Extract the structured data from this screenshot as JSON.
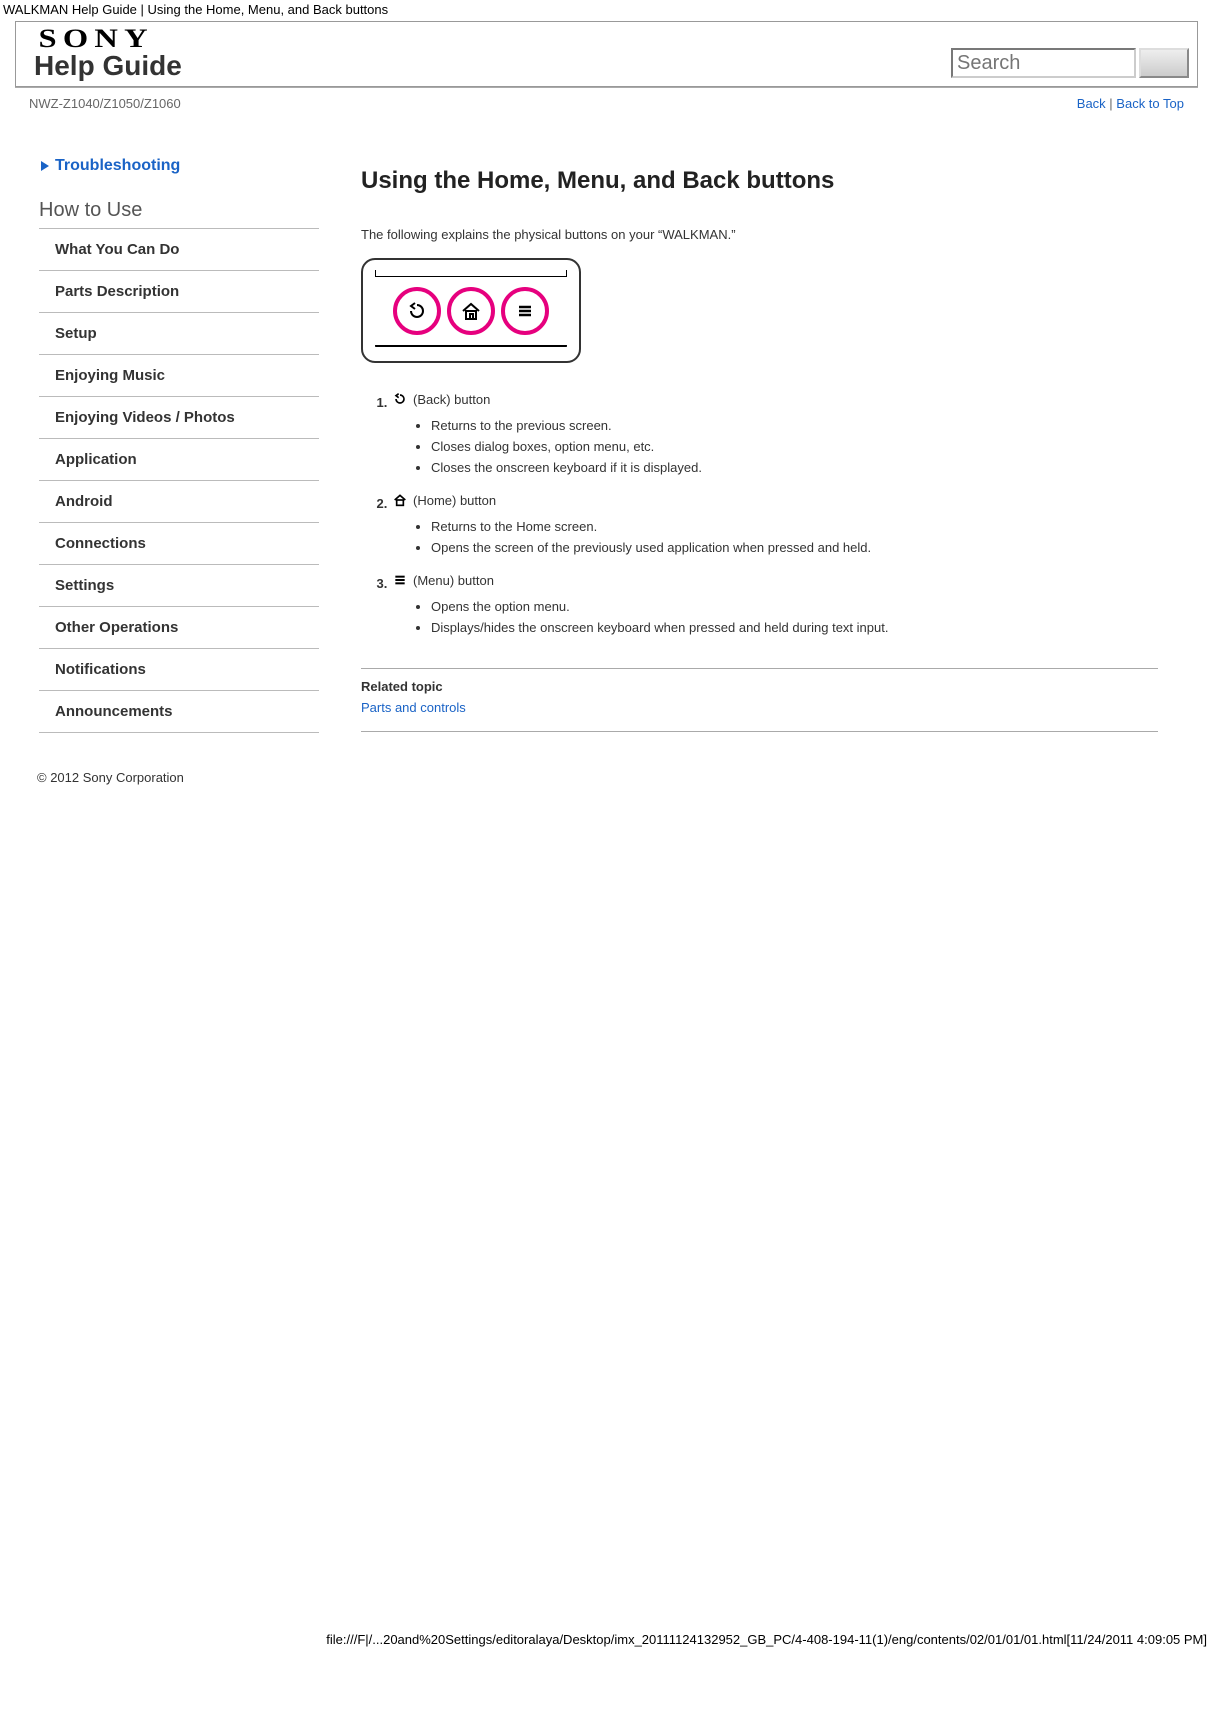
{
  "browserTitle": "WALKMAN Help Guide | Using the Home, Menu, and Back buttons",
  "brand": "SONY",
  "headerTitle": "Help Guide",
  "search": {
    "placeholder": "Search"
  },
  "model": "NWZ-Z1040/Z1050/Z1060",
  "links": {
    "back": "Back",
    "sep": " | ",
    "top": "Back to Top"
  },
  "sidebar": {
    "troubleshooting": "Troubleshooting",
    "sectionTitle": "How to Use",
    "items": [
      "What You Can Do",
      "Parts Description",
      "Setup",
      "Enjoying Music",
      "Enjoying Videos / Photos",
      "Application",
      "Android",
      "Connections",
      "Settings",
      "Other Operations",
      "Notifications",
      "Announcements"
    ]
  },
  "main": {
    "title": "Using the Home, Menu, and Back buttons",
    "intro": "The following explains the physical buttons on your “WALKMAN.”",
    "buttons": [
      {
        "label": "(Back) button",
        "bullets": [
          "Returns to the previous screen.",
          "Closes dialog boxes, option menu, etc.",
          "Closes the onscreen keyboard if it is displayed."
        ]
      },
      {
        "label": "(Home) button",
        "bullets": [
          "Returns to the Home screen.",
          "Opens the screen of the previously used application when pressed and held."
        ]
      },
      {
        "label": "(Menu) button",
        "bullets": [
          "Opens the option menu.",
          "Displays/hides the onscreen keyboard when pressed and held during text input."
        ]
      }
    ],
    "relatedTitle": "Related topic",
    "relatedLink": "Parts and controls"
  },
  "copyright": "© 2012 Sony Corporation",
  "footerPath": "file:///F|/...20and%20Settings/editoralaya/Desktop/imx_20111124132952_GB_PC/4-408-194-11(1)/eng/contents/02/01/01/01.html[11/24/2011 4:09:05 PM]"
}
